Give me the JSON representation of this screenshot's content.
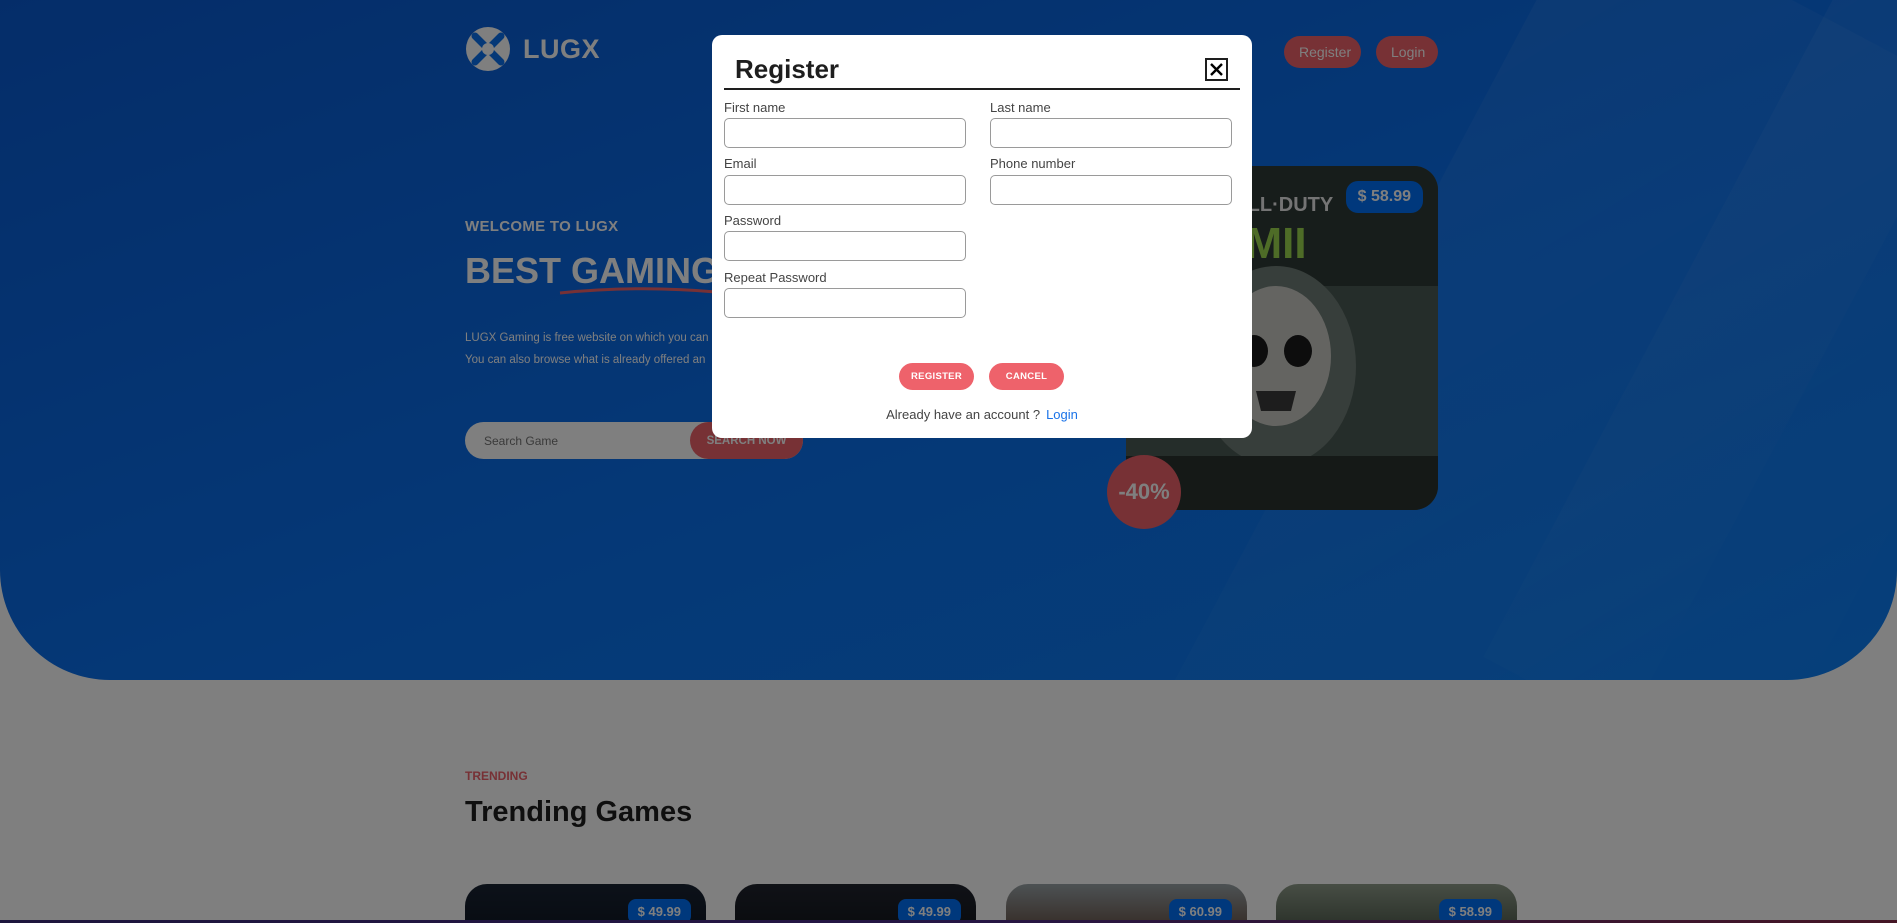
{
  "header": {
    "logo_text": "LUGX",
    "nav": {
      "register": "Register",
      "login": "Login"
    }
  },
  "hero": {
    "kicker": "WELCOME TO LUGX",
    "title": "BEST GAMING",
    "desc_line1": "LUGX Gaming is free website on which you can",
    "desc_line2": "You can also browse what is already offered an",
    "search": {
      "placeholder": "Search Game",
      "button": "SEARCH NOW"
    },
    "featured": {
      "price": "$ 58.99",
      "discount": "-40%"
    }
  },
  "trending": {
    "kicker": "TRENDING",
    "title": "Trending Games",
    "cards": [
      {
        "price": "$ 49.99"
      },
      {
        "price": "$ 49.99"
      },
      {
        "price": "$ 60.99"
      },
      {
        "price": "$ 58.99"
      }
    ]
  },
  "modal": {
    "title": "Register",
    "fields": {
      "first_name": {
        "label": "First name",
        "value": ""
      },
      "last_name": {
        "label": "Last name",
        "value": ""
      },
      "email": {
        "label": "Email",
        "value": ""
      },
      "phone": {
        "label": "Phone number",
        "value": ""
      },
      "password": {
        "label": "Password",
        "value": ""
      },
      "repeat_password": {
        "label": "Repeat Password",
        "value": ""
      }
    },
    "register_button": "REGISTER",
    "cancel_button": "CANCEL",
    "footer_text": "Already have an account ?",
    "footer_link": "Login"
  },
  "colors": {
    "hero_blue": "#0b71ee",
    "accent_red": "#ee626b",
    "price_blue": "#0071f8",
    "link_blue": "#1a73e8"
  }
}
